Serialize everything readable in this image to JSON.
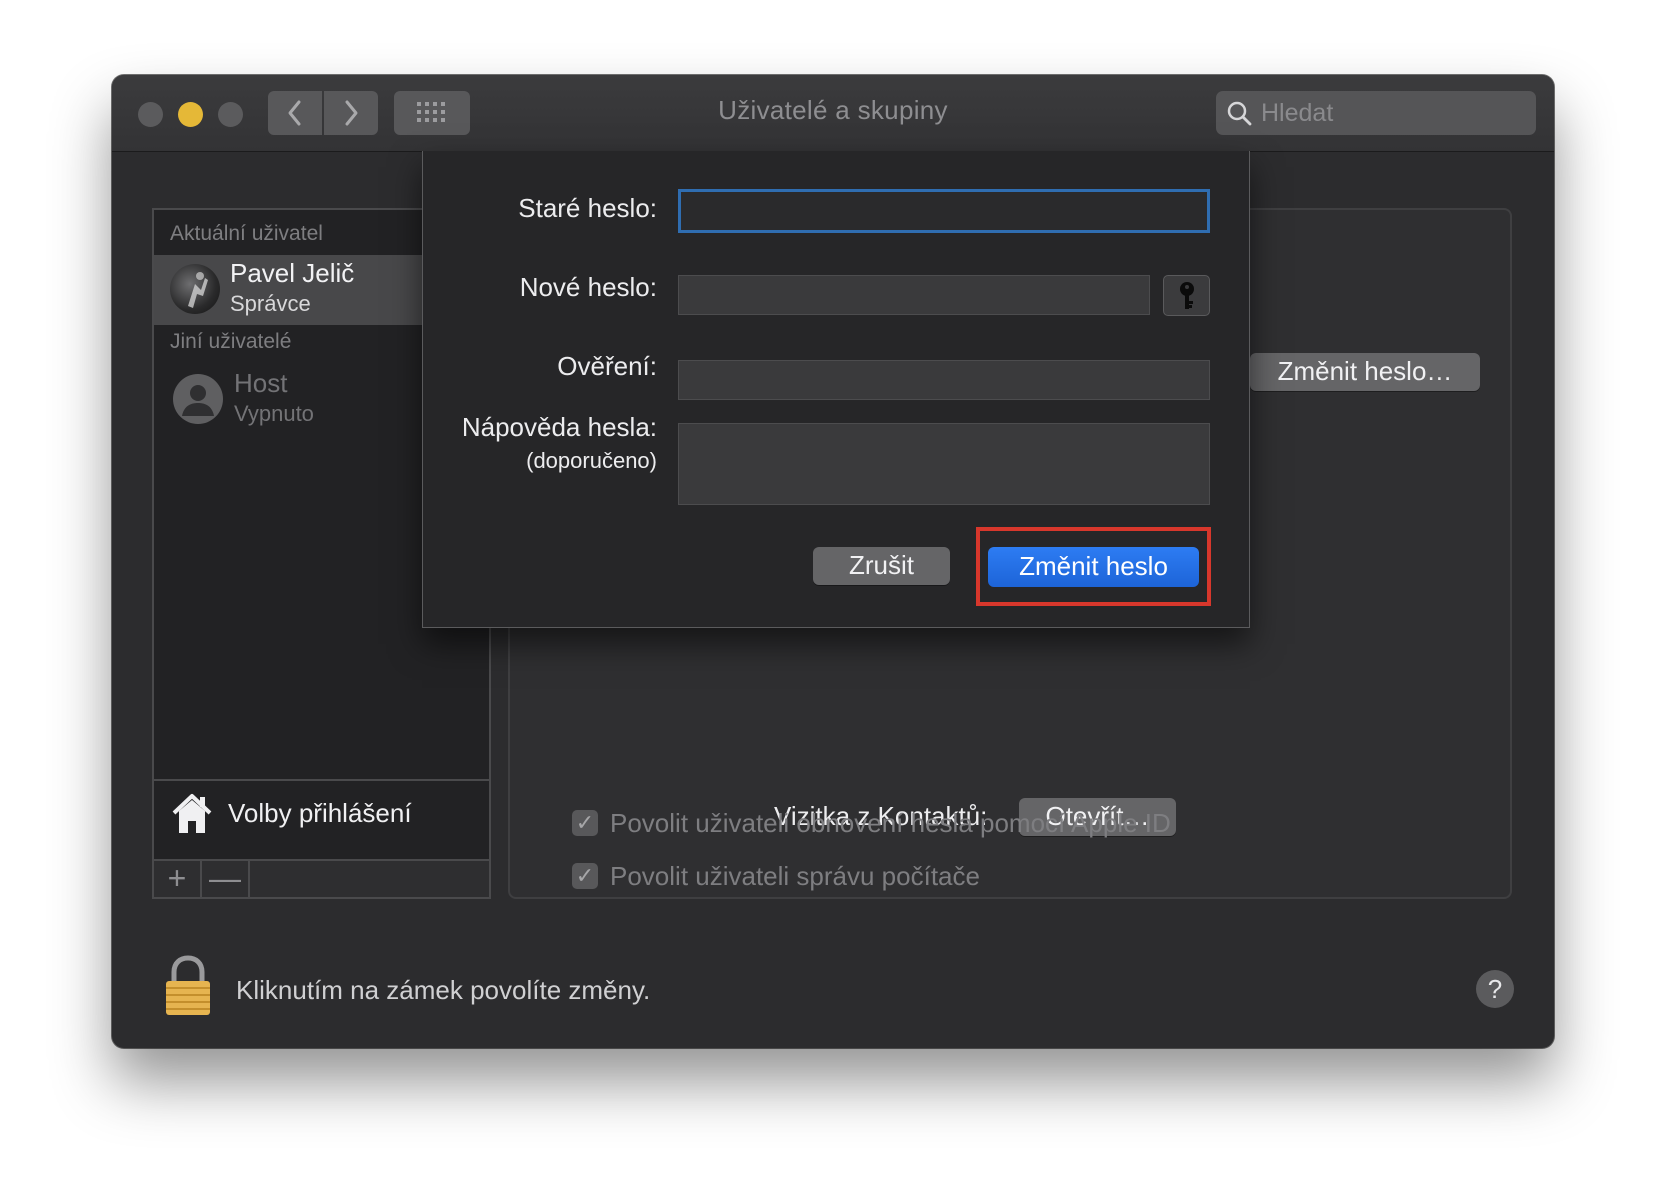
{
  "window": {
    "title": "Uživatelé a skupiny",
    "search_placeholder": "Hledat"
  },
  "sidebar": {
    "current_section": "Aktuální uživatel",
    "current_user": {
      "name": "Pavel Jelič",
      "role": "Správce"
    },
    "other_section": "Jiní uživatelé",
    "other_users": [
      {
        "name": "Host",
        "status": "Vypnuto"
      }
    ],
    "login_options": "Volby přihlášení",
    "add_label": "+",
    "remove_label": "—"
  },
  "detail": {
    "change_password_button": "Změnit heslo…",
    "contacts_card_label": "Vizitka z Kontaktů:",
    "open_button": "Otevřít…",
    "checkboxes": [
      {
        "label": "Povolit uživateli obnovení hesla pomocí Apple ID",
        "checked": true
      },
      {
        "label": "Povolit uživateli správu počítače",
        "checked": true
      }
    ]
  },
  "footer": {
    "lock_text": "Kliknutím na zámek povolíte změny.",
    "help": "?"
  },
  "dialog": {
    "old_password_label": "Staré heslo:",
    "new_password_label": "Nové heslo:",
    "verify_label": "Ověření:",
    "hint_label": "Nápověda hesla:",
    "hint_sublabel": "(doporučeno)",
    "old_password_value": "",
    "new_password_value": "",
    "verify_value": "",
    "hint_value": "",
    "cancel_button": "Zrušit",
    "confirm_button": "Změnit heslo"
  },
  "colors": {
    "accent": "#2d7cf3",
    "highlight_frame": "#d7372c",
    "minimize_light": "#e5b837"
  },
  "icons": [
    "search-icon",
    "grid-icon",
    "chevron-left-icon",
    "chevron-right-icon",
    "house-icon",
    "lock-icon",
    "key-icon",
    "user-silhouette-icon",
    "checkmark-icon"
  ]
}
